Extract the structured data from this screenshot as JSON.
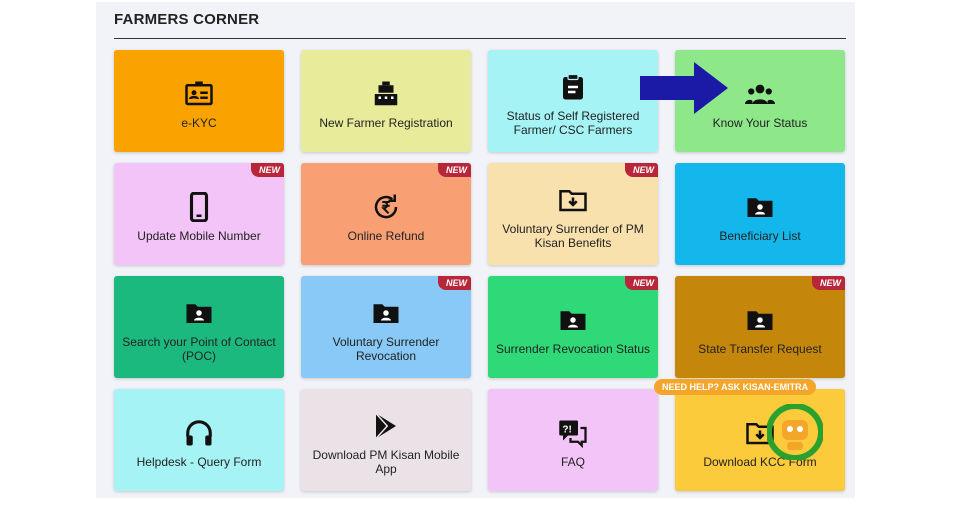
{
  "header": {
    "title": "FARMERS CORNER"
  },
  "tiles": [
    {
      "label": "e-KYC",
      "icon": "id-card-icon",
      "color": "#f9a200",
      "new": false
    },
    {
      "label": "New Farmer Registration",
      "icon": "cash-register-icon",
      "color": "#e8ec9a",
      "new": false
    },
    {
      "label": "Status of Self Registered Farmer/ CSC Farmers",
      "icon": "clipboard-icon",
      "color": "#a6f3f6",
      "new": false
    },
    {
      "label": "Know Your Status",
      "icon": "users-icon",
      "color": "#8ee88a",
      "new": false
    },
    {
      "label": "Update Mobile Number",
      "icon": "mobile-icon",
      "color": "#f3c4f7",
      "new": true
    },
    {
      "label": "Online Refund",
      "icon": "rupee-refund-icon",
      "color": "#f89f74",
      "new": true
    },
    {
      "label": "Voluntary Surrender of PM Kisan Benefits",
      "icon": "folder-download-icon",
      "color": "#f9e1ad",
      "new": true
    },
    {
      "label": "Beneficiary List",
      "icon": "folder-user-icon",
      "color": "#14b7ec",
      "new": false
    },
    {
      "label": "Search your Point of Contact (POC)",
      "icon": "folder-user-icon",
      "color": "#1cb97f",
      "new": false
    },
    {
      "label": "Voluntary Surrender Revocation",
      "icon": "folder-user-icon",
      "color": "#88c9f7",
      "new": true
    },
    {
      "label": "Surrender Revocation Status",
      "icon": "folder-user-icon",
      "color": "#2fd977",
      "new": true
    },
    {
      "label": "State Transfer Request",
      "icon": "folder-user-icon",
      "color": "#c4870c",
      "new": true
    },
    {
      "label": "Helpdesk - Query Form",
      "icon": "headphones-icon",
      "color": "#a6f3f6",
      "new": false
    },
    {
      "label": "Download PM Kisan Mobile App",
      "icon": "play-store-icon",
      "color": "#ebe2e8",
      "new": false
    },
    {
      "label": "FAQ",
      "icon": "faq-icon",
      "color": "#f3c4f7",
      "new": false
    },
    {
      "label": "Download KCC Form",
      "icon": "folder-download-icon",
      "color": "#fbcb3c",
      "new": false
    }
  ],
  "badge_text": "NEW",
  "help": {
    "text": "NEED HELP? ASK KISAN-EMITRA"
  },
  "arrow_color": "#1a1aa6"
}
